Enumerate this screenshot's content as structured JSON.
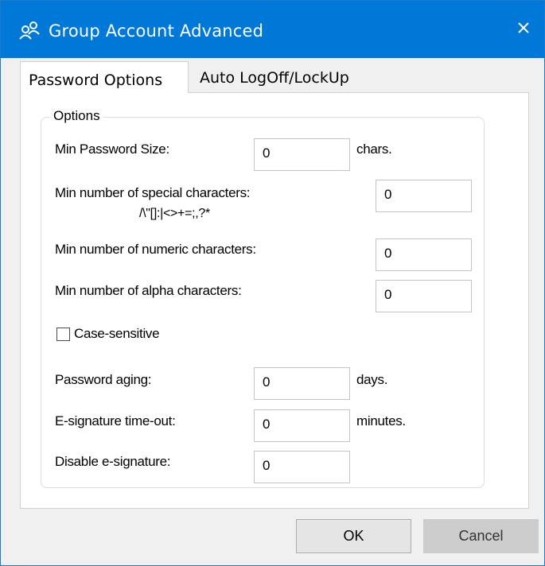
{
  "window": {
    "title": "Group Account Advanced",
    "close_label": "close",
    "accent": "#0078d7"
  },
  "tabs": [
    {
      "label": "Password Options",
      "active": true
    },
    {
      "label": "Auto LogOff/LockUp",
      "active": false
    }
  ],
  "options": {
    "legend": "Options",
    "min_password_size": {
      "label": "Min Password Size:",
      "value": "0",
      "unit": "chars."
    },
    "min_special": {
      "label": "Min number of special characters:",
      "hint": "/\\\"[]:|<>+=;,?*",
      "value": "0"
    },
    "min_numeric": {
      "label": "Min number of numeric characters:",
      "value": "0"
    },
    "min_alpha": {
      "label": "Min number of alpha characters:",
      "value": "0"
    },
    "case_sensitive": {
      "label": "Case-sensitive",
      "checked": false
    },
    "password_aging": {
      "label": "Password aging:",
      "value": "0",
      "unit": "days."
    },
    "esig_timeout": {
      "label": "E-signature time-out:",
      "value": "0",
      "unit": "minutes."
    },
    "disable_esig": {
      "label": "Disable e-signature:",
      "value": "0"
    }
  },
  "buttons": {
    "ok": "OK",
    "cancel": "Cancel"
  },
  "icons": {
    "title_icon": "group-users-icon",
    "close_icon": "close-icon"
  }
}
